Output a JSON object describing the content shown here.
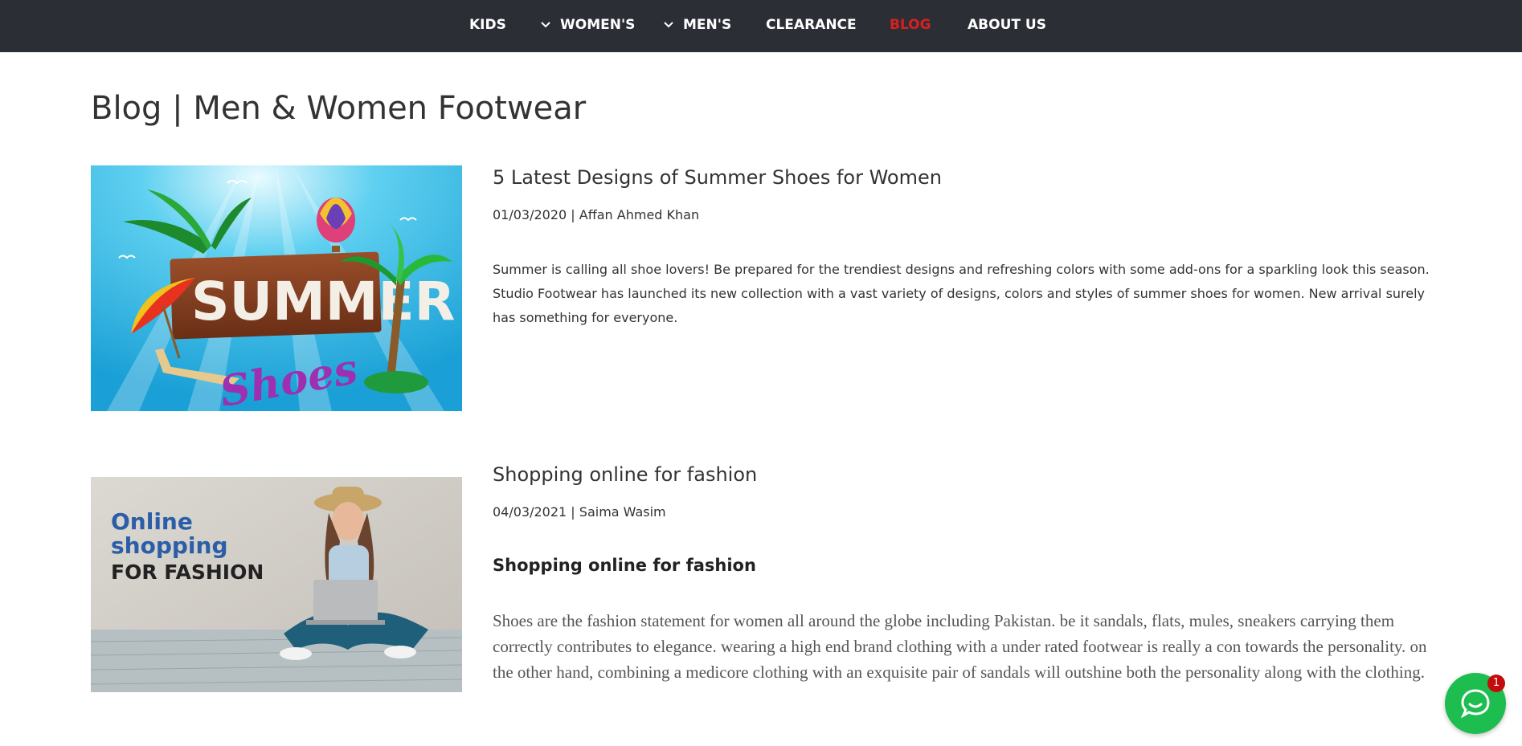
{
  "nav": {
    "items": [
      {
        "label": "KIDS",
        "has_dropdown": false,
        "active": false
      },
      {
        "label": "WOMEN'S",
        "has_dropdown": true,
        "active": false
      },
      {
        "label": "MEN'S",
        "has_dropdown": true,
        "active": false
      },
      {
        "label": "CLEARANCE",
        "has_dropdown": false,
        "active": false
      },
      {
        "label": "BLOG",
        "has_dropdown": false,
        "active": true
      },
      {
        "label": "ABOUT US",
        "has_dropdown": false,
        "active": false
      }
    ],
    "background": "#2c2e36",
    "active_color": "#d81f1f"
  },
  "page": {
    "title": "Blog | Men & Women Footwear"
  },
  "posts": [
    {
      "title": "5 Latest Designs of Summer Shoes for Women",
      "meta": "01/03/2020 | Affan Ahmed Khan",
      "excerpt": "Summer is calling all shoe lovers! Be prepared for the trendiest designs and refreshing colors with some add-ons for a sparkling look this season. Studio Footwear has launched its new collection with a vast variety of designs, colors and styles of summer shoes for women. New arrival surely has something for everyone.",
      "image": {
        "sign_text": "SUMMER",
        "script_text": "Shoes",
        "icons": [
          "palm-tree-icon",
          "hot-air-balloon-icon",
          "beach-umbrella-icon",
          "sun-lounger-icon"
        ]
      }
    },
    {
      "title": "Shopping online for fashion",
      "meta": "04/03/2021 | Saima Wasim",
      "subheading": "Shopping online for fashion",
      "body": "Shoes are the fashion statement for women all around the globe including Pakistan. be it sandals, flats, mules, sneakers carrying them correctly contributes to elegance. wearing a high end brand clothing with a under rated footwear is really a con towards the personality. on the other hand, combining a medicore clothing with an exquisite pair of sandals will outshine both the personality along with the clothing.",
      "image": {
        "line1": "Online",
        "line2": "shopping",
        "line3": "FOR FASHION"
      }
    }
  ],
  "chat": {
    "badge_count": "1",
    "color": "#1ebd4f"
  }
}
